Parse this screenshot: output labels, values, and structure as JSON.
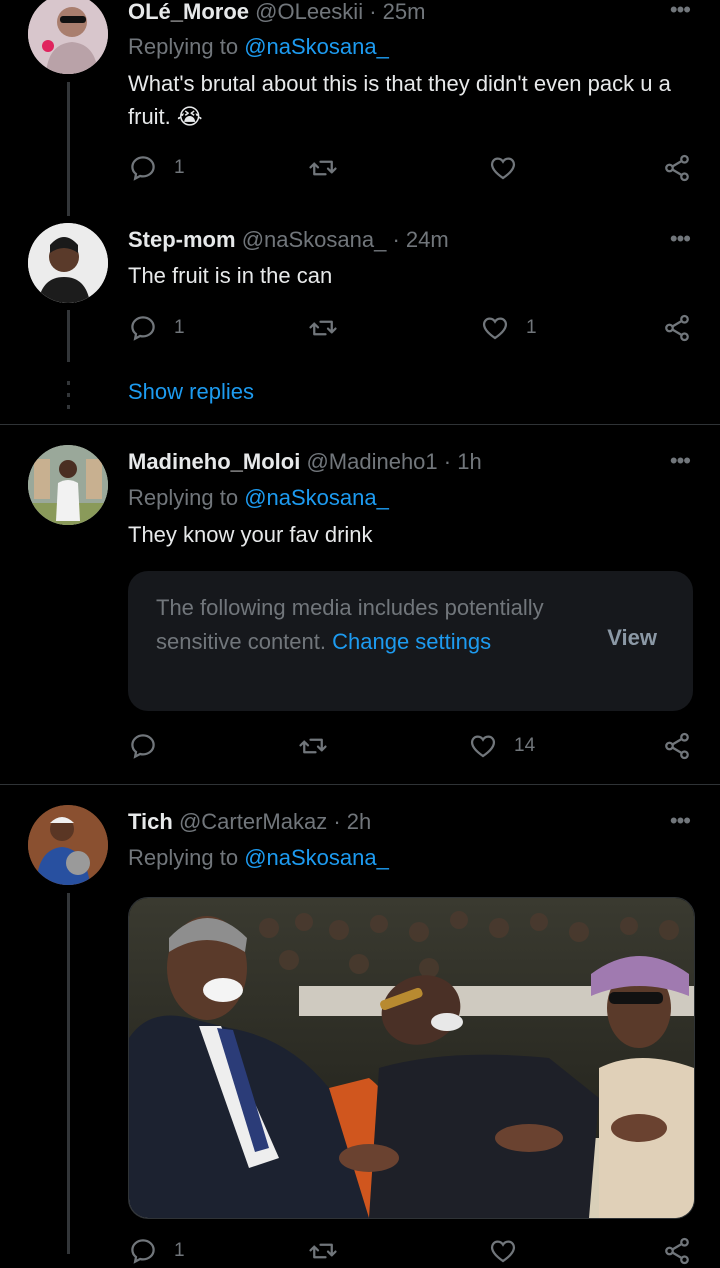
{
  "tweets": [
    {
      "name": "OLé_Moroe",
      "handle": "@OLeeskii",
      "sep": "·",
      "time": "25m",
      "replying_prefix": "Replying to",
      "replying_handle": "@naSkosana_",
      "text": "What's brutal about this is that they didn't even pack u a fruit. 😭",
      "reply_count": "1",
      "retweet_count": "",
      "like_count": ""
    },
    {
      "name": "Step-mom",
      "handle": "@naSkosana_",
      "sep": "·",
      "time": "24m",
      "text": "The fruit is in the can",
      "reply_count": "1",
      "retweet_count": "",
      "like_count": "1"
    },
    {
      "name": "Madineho_Moloi",
      "handle": "@Madineho1",
      "sep": "·",
      "time": "1h",
      "replying_prefix": "Replying to",
      "replying_handle": "@naSkosana_",
      "text": "They know your fav drink",
      "reply_count": "",
      "retweet_count": "",
      "like_count": "14"
    },
    {
      "name": "Tich",
      "handle": "@CarterMakaz",
      "sep": "·",
      "time": "2h",
      "replying_prefix": "Replying to",
      "replying_handle": "@naSkosana_",
      "reply_count": "1"
    }
  ],
  "show_replies": "Show replies",
  "more_glyph": "•••",
  "sensitive": {
    "text": "The following media includes potentially sensitive content.",
    "change_link": "Change settings",
    "view_label": "View"
  },
  "colors": {
    "background": "#000000",
    "accent": "#1d9bf0",
    "muted": "#71767b",
    "divider": "#2f3336"
  }
}
